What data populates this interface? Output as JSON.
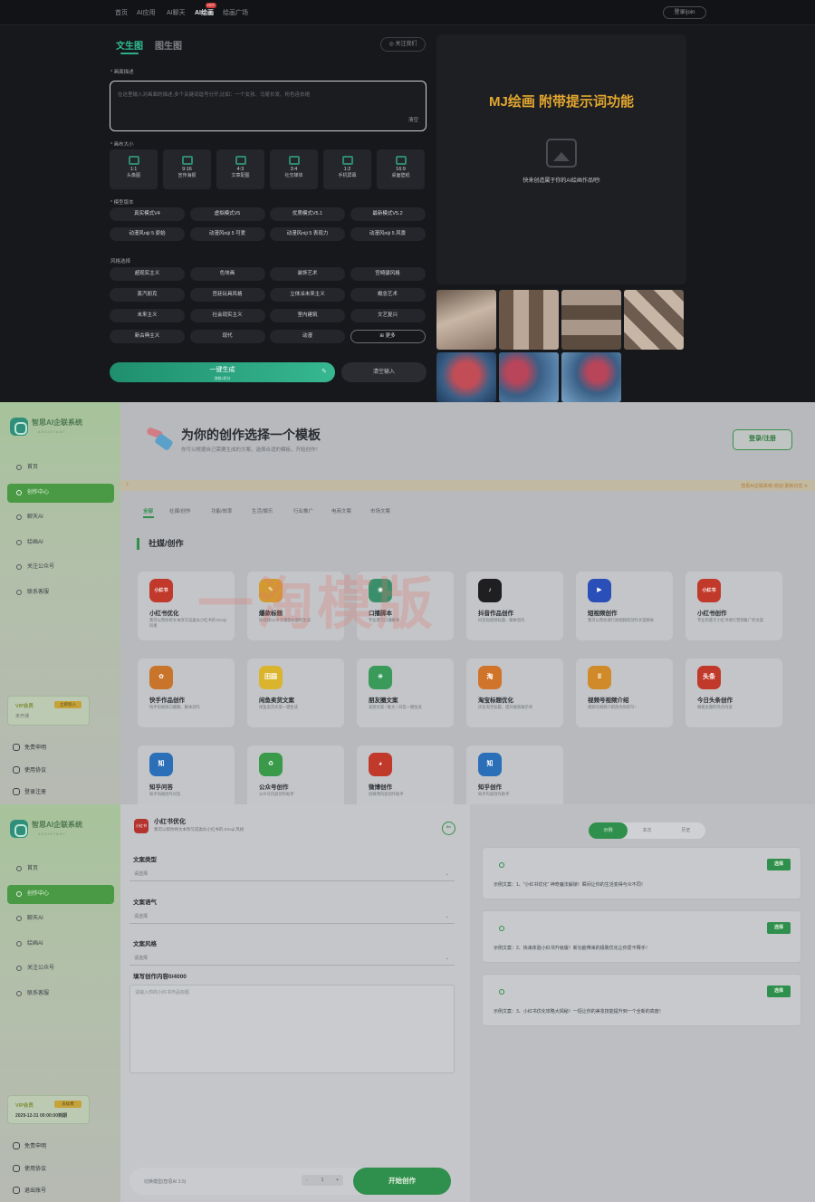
{
  "s1": {
    "nav": [
      "首页",
      "AI应用",
      "AI聊天",
      "AI绘画",
      "绘画广场"
    ],
    "nav_active": 3,
    "hot_badge": "HOT",
    "login": "登录/join",
    "tabs": [
      "文生图",
      "图生图"
    ],
    "follow": "关注我们",
    "desc_label": "* 画面描述",
    "prompt_placeholder": "在这里输入对画面的描述,多个关键词逗号分开,比如：一个女孩、马尾长发、粉色连衣裙",
    "prompt_clear": "清空",
    "size_label": "* 画布大小",
    "ratios": [
      {
        "v": "1:1",
        "n": "头像图"
      },
      {
        "v": "9:16",
        "n": "宣传海报"
      },
      {
        "v": "4:3",
        "n": "文章配图"
      },
      {
        "v": "3:4",
        "n": "社交媒体"
      },
      {
        "v": "1:2",
        "n": "手机屏幕"
      },
      {
        "v": "16:9",
        "n": "桌面壁纸"
      }
    ],
    "model_label": "* 模型版本",
    "models": [
      "真实模式V4",
      "虚拟模式V5",
      "优质模式V5.1",
      "最新模式V5.2",
      "动漫风niji 5 原始",
      "动漫风niji 5 可爱",
      "动漫风niji 5 表现力",
      "动漫风niji 5 风景"
    ],
    "style_label": "风格选择",
    "styles": [
      "超现实主义",
      "色块画",
      "装饰艺术",
      "宫崎骏风格",
      "蒸汽朋克",
      "宫廷玩具风格",
      "立体派未来主义",
      "概念艺术",
      "未来主义",
      "社会现实主义",
      "室内建筑",
      "文艺复兴",
      "新古典主义",
      "现代",
      "动漫",
      "更多"
    ],
    "generate": "一键生成",
    "generate_sub": "消耗1积分",
    "clear_input": "清空输入",
    "mj_title": "MJ绘画 附带提示词功能",
    "mj_sub": "快来创造属于你的AI绘画作品吧!"
  },
  "s2": {
    "brand": "智思AI企联系统",
    "brand_sub": "ASSISTANT",
    "nav": [
      "首页",
      "创作中心",
      "聊天AI",
      "绘画AI",
      "关注公众号",
      "联系客服"
    ],
    "nav_active": 1,
    "vip": {
      "title": "VIP会员",
      "btn": "立即加入",
      "sub": "未开通"
    },
    "bottom_nav": [
      "免责申明",
      "使用协议",
      "登录注册"
    ],
    "title": "为你的创作选择一个模板",
    "subtitle": "你可以根据自己需要生成的文案，选择合适的模板，开始创作！",
    "login_btn": "登录/注册",
    "notice": "智思AI企联系统-欢迎-更新日志 ✕",
    "categories": [
      "全部",
      "社媒/创作",
      "功能/效率",
      "生活/娱乐",
      "行业推广",
      "电商文案",
      "市场文案"
    ],
    "section": "社媒/创作",
    "watermark": "一淘模版",
    "cards": [
      {
        "name": "小红书优化",
        "desc": "我可以帮你将文本改写成类似小红书的 Emoji 风格",
        "icon": "小红书",
        "color": "#c0392b"
      },
      {
        "name": "爆款标题",
        "desc": "短视频/公众号爆款标题的生成",
        "icon": "✎",
        "color": "#d29a30"
      },
      {
        "name": "口播脚本",
        "desc": "专业撰写口播脚本",
        "icon": "◉",
        "color": "#3a8f6a"
      },
      {
        "name": "抖音作品创作",
        "desc": "抖音短视频标题、脚本创作",
        "icon": "♪",
        "color": "#1f1f22"
      },
      {
        "name": "短视频创作",
        "desc": "我可以帮你进行短视频的创作文案脚本",
        "icon": "▶",
        "color": "#2a4fb8"
      },
      {
        "name": "小红书创作",
        "desc": "专业的基于小红书进行营销推广的文案",
        "icon": "小红书",
        "color": "#c0392b"
      },
      {
        "name": "快手作品创作",
        "desc": "快手短视频口播稿、脚本创作",
        "icon": "✿",
        "color": "#c8742a"
      },
      {
        "name": "闲鱼卖货文案",
        "desc": "闲鱼卖货文案一键生成",
        "icon": "田园",
        "color": "#d9b42c"
      },
      {
        "name": "朋友圈文案",
        "desc": "发朋文案 / 推文 / 日签一键生成",
        "icon": "❋",
        "color": "#3a9a5a"
      },
      {
        "name": "淘宝标题优化",
        "desc": "优化淘宝标题，提升搜索展示率",
        "icon": "淘",
        "color": "#d0742a"
      },
      {
        "name": "视频号视频介绍",
        "desc": "视频号视频介绍改为你的写~",
        "icon": "ʬ",
        "color": "#d08a2a"
      },
      {
        "name": "今日头条创作",
        "desc": "根据主题的热点内容",
        "icon": "头条",
        "color": "#c0392b"
      },
      {
        "name": "知乎问答",
        "desc": "知乎风格创作问答",
        "icon": "知",
        "color": "#2a6fb8"
      },
      {
        "name": "公众号创作",
        "desc": "公众号内容创作助手",
        "icon": "♻",
        "color": "#3a9a4a"
      },
      {
        "name": "微博创作",
        "desc": "短微博内容创作助手",
        "icon": "◕",
        "color": "#c0392b"
      },
      {
        "name": "知乎创作",
        "desc": "知乎内容创作助手",
        "icon": "知",
        "color": "#2a6fb8"
      }
    ]
  },
  "s3": {
    "brand": "智思AI企联系统",
    "brand_sub": "ASSISTANT",
    "nav": [
      "首页",
      "创作中心",
      "聊天AI",
      "绘画AI",
      "关注公众号",
      "联系客服"
    ],
    "nav_active": 1,
    "vip": {
      "title": "VIP会员",
      "btn": "去续费",
      "sub": "2029-12-31 00:00:00到期"
    },
    "bottom_nav": [
      "免责申明",
      "使用协议",
      "退出账号"
    ],
    "template_icon": "小红书",
    "template_title": "小红书优化",
    "template_desc": "我可以帮你将文本改写成类似小红书的 Emoji 风格",
    "back": "⇐",
    "fields": [
      {
        "label": "文案类型",
        "value": "请选择"
      },
      {
        "label": "文案语气",
        "value": "请选择"
      },
      {
        "label": "文案风格",
        "value": "请选择"
      }
    ],
    "content_label": "填写创作内容0/4000",
    "content_placeholder": "请输入你的小红书作品标题",
    "model": "切换模型(智思AI 3.5)",
    "stepper": {
      "minus": "-",
      "value": "1",
      "plus": "+"
    },
    "start": "开始创作",
    "segs": [
      "示例",
      "本次",
      "历史"
    ],
    "seg_active": 0,
    "pick": "选择",
    "examples": [
      "示例文案：1、\"小红书优化\" 神奇魔法解锁！瞬间让你的生活变得与众不同！",
      "示例文案：2、快来体验小红书升级版！新功能带来的极致优化让你爱不释手！",
      "示例文案：3、小红书优化攻略大揭秘！一招让你的美妆技能提升到一个全新的高度！"
    ]
  }
}
